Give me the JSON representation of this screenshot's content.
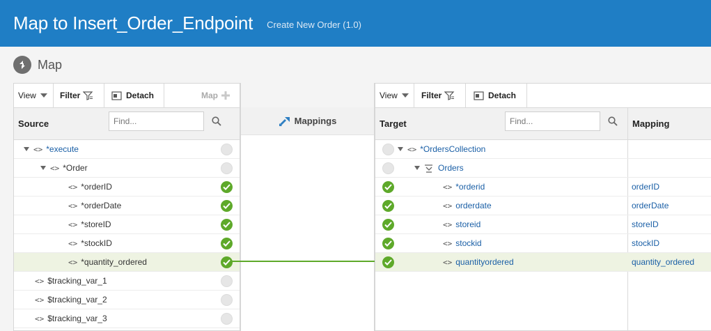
{
  "header": {
    "title": "Map to Insert_Order_Endpoint",
    "subtitle": "Create New Order (1.0)"
  },
  "map": {
    "label": "Map"
  },
  "source": {
    "toolbar": {
      "view": "View",
      "filter": "Filter",
      "detach": "Detach",
      "map": "Map"
    },
    "column_label": "Source",
    "find_placeholder": "Find...",
    "rows": [
      {
        "name": "*execute",
        "mapped": false
      },
      {
        "name": "*Order",
        "mapped": false
      },
      {
        "name": "*orderID",
        "mapped": true
      },
      {
        "name": "*orderDate",
        "mapped": true
      },
      {
        "name": "*storeID",
        "mapped": true
      },
      {
        "name": "*stockID",
        "mapped": true
      },
      {
        "name": "*quantity_ordered",
        "mapped": true,
        "selected": true
      },
      {
        "name": "$tracking_var_1",
        "mapped": false
      },
      {
        "name": "$tracking_var_2",
        "mapped": false
      },
      {
        "name": "$tracking_var_3",
        "mapped": false
      }
    ]
  },
  "middle": {
    "label": "Mappings"
  },
  "target": {
    "toolbar": {
      "view": "View",
      "filter": "Filter",
      "detach": "Detach"
    },
    "column_label": "Target",
    "find_placeholder": "Find...",
    "mapping_label": "Mapping",
    "rows": [
      {
        "name": "*OrdersCollection",
        "mapped": false,
        "mapping": ""
      },
      {
        "name": "Orders",
        "mapped": false,
        "mapping": ""
      },
      {
        "name": "*orderid",
        "mapped": true,
        "mapping": "orderID"
      },
      {
        "name": "orderdate",
        "mapped": true,
        "mapping": "orderDate"
      },
      {
        "name": "storeid",
        "mapped": true,
        "mapping": "storeID"
      },
      {
        "name": "stockid",
        "mapped": true,
        "mapping": "stockID"
      },
      {
        "name": "quantityordered",
        "mapped": true,
        "mapping": "quantity_ordered",
        "selected": true
      }
    ]
  },
  "colors": {
    "header": "#1f7ec5",
    "mapped": "#5ea92a",
    "link": "#1a5fa6",
    "highlight": "#eef3e2"
  }
}
